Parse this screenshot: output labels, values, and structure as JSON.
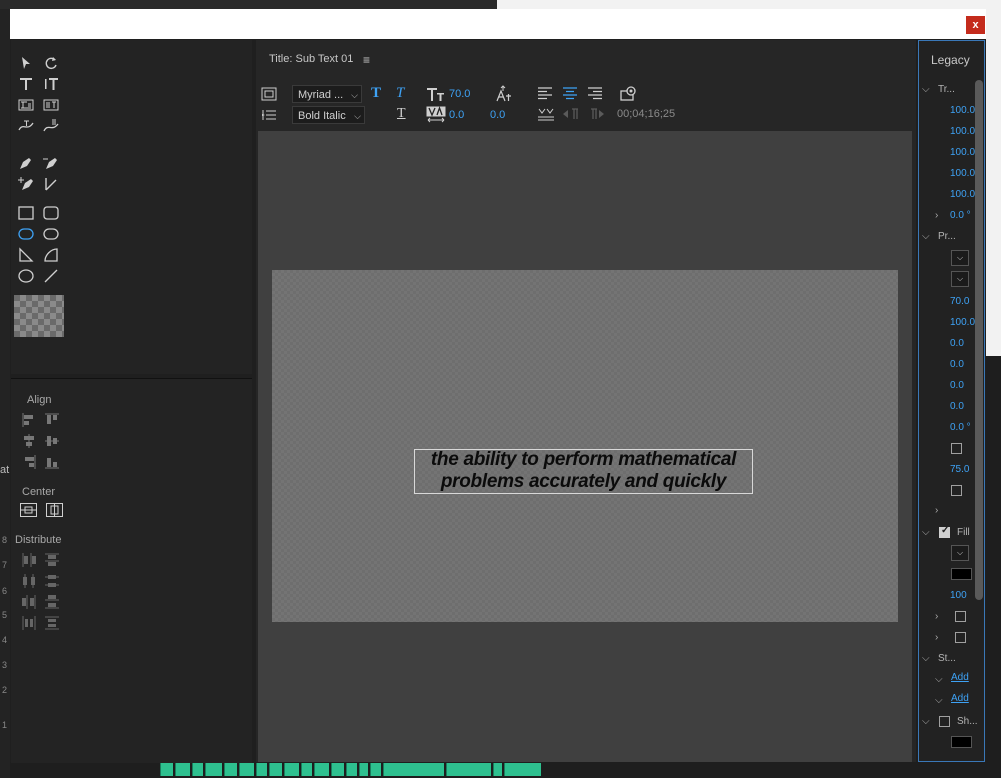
{
  "window": {
    "close_glyph": "x",
    "panel_title_prefix": "Title: ",
    "panel_title": "Sub Text 01",
    "menu_glyph": "≡"
  },
  "toolbar": {
    "font_family": "Myriad ...",
    "font_style": "Bold Italic",
    "font_size": "70.0",
    "kerning": "0.0",
    "tracking": "0.0",
    "timecode": "00;04;16;25"
  },
  "align_panel": {
    "align_label": "Align",
    "center_label": "Center",
    "distribute_label": "Distribute"
  },
  "canvas": {
    "text_line1": "the ability to perform mathematical",
    "text_line2": "problems accurately and quickly"
  },
  "legacy_panel": {
    "title": "Legacy",
    "rows": {
      "transform": "Tr...",
      "t1": "100.0",
      "t2": "100.0",
      "t3": "100.0",
      "t4": "100.0",
      "t5": "100.0",
      "rotation": "0.0 °",
      "properties": "Pr...",
      "p_size": "70.0",
      "p_aspect": "100.0",
      "p1": "0.0",
      "p2": "0.0",
      "p3": "0.0",
      "p4": "0.0",
      "p_slant": "0.0 °",
      "p_small": "75.0",
      "fill": "Fill",
      "fill_opacity": "100",
      "strokes": "St...",
      "add1": "Add",
      "add2": "Add",
      "shadow": "Sh..."
    }
  },
  "background_app": {
    "side_label": "at",
    "track_numbers": [
      "8",
      "7",
      "6",
      "5",
      "4",
      "3",
      "2",
      "1"
    ]
  },
  "colors": {
    "accent_blue": "#3ea2f5",
    "close_red": "#c42b1c",
    "timeline_clip": "#2ec08f"
  }
}
